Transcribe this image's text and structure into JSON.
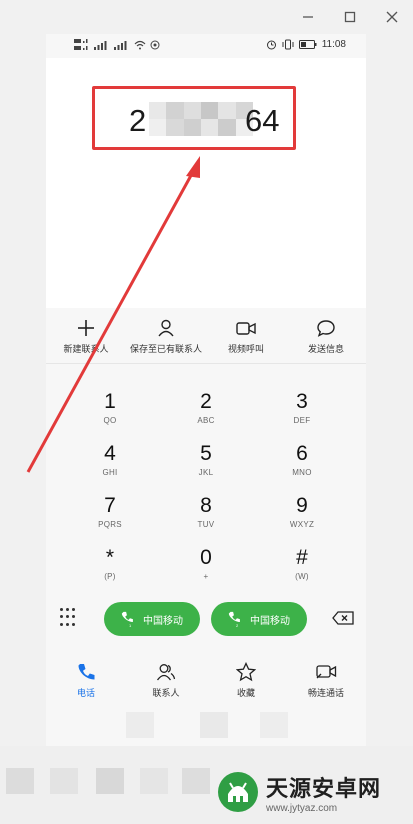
{
  "statusbar": {
    "time": "11:08"
  },
  "dialer": {
    "number_prefix": "2",
    "number_suffix": "64"
  },
  "actions": [
    {
      "label": "新建联系人",
      "icon": "plus-icon"
    },
    {
      "label": "保存至已有联系人",
      "icon": "person-icon"
    },
    {
      "label": "视频呼叫",
      "icon": "video-icon"
    },
    {
      "label": "发送信息",
      "icon": "message-icon"
    }
  ],
  "keys": [
    {
      "digit": "1",
      "sub": "QO"
    },
    {
      "digit": "2",
      "sub": "ABC"
    },
    {
      "digit": "3",
      "sub": "DEF"
    },
    {
      "digit": "4",
      "sub": "GHI"
    },
    {
      "digit": "5",
      "sub": "JKL"
    },
    {
      "digit": "6",
      "sub": "MNO"
    },
    {
      "digit": "7",
      "sub": "PQRS"
    },
    {
      "digit": "8",
      "sub": "TUV"
    },
    {
      "digit": "9",
      "sub": "WXYZ"
    },
    {
      "digit": "*",
      "sub": "(P)"
    },
    {
      "digit": "0",
      "sub": "+"
    },
    {
      "digit": "#",
      "sub": "(W)"
    }
  ],
  "call": {
    "sim1_label": "中国移动",
    "sim2_label": "中国移动"
  },
  "tabs": [
    {
      "label": "电话",
      "icon": "phone-icon"
    },
    {
      "label": "联系人",
      "icon": "contacts-icon"
    },
    {
      "label": "收藏",
      "icon": "star-icon"
    },
    {
      "label": "畅连通话",
      "icon": "video-call-icon"
    }
  ],
  "watermark": {
    "title": "天源安卓网",
    "url": "www.jytyaz.com"
  },
  "colors": {
    "call_green": "#3db249",
    "highlight_red": "#e23a3a",
    "active_blue": "#1a73e8"
  }
}
